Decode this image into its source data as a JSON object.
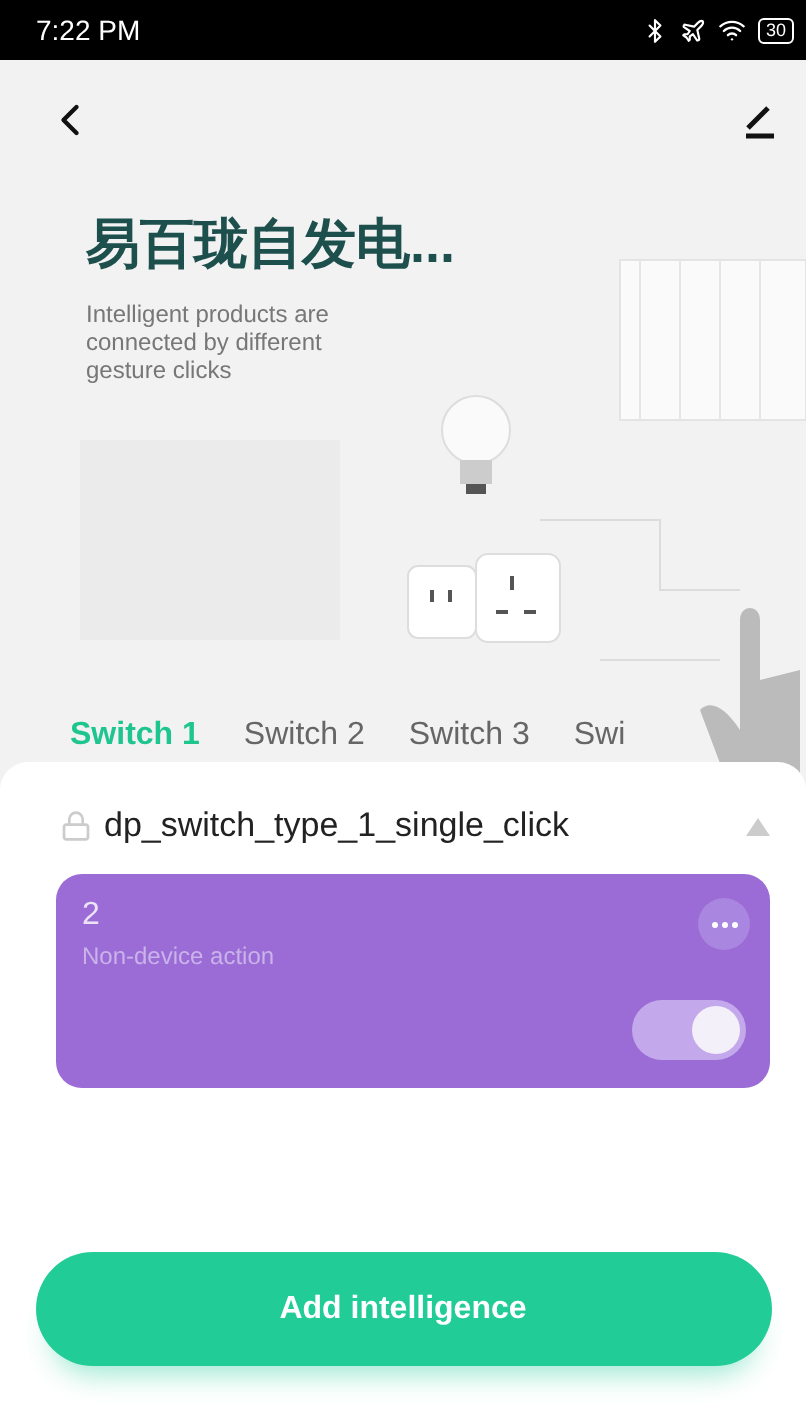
{
  "status_bar": {
    "time": "7:22 PM",
    "battery": "30"
  },
  "hero": {
    "title": "易百珑自发电...",
    "subtitle": "Intelligent products are connected by different gesture clicks"
  },
  "tabs": [
    {
      "label": "Switch 1",
      "selected": true
    },
    {
      "label": "Switch 2",
      "selected": false
    },
    {
      "label": "Switch 3",
      "selected": false
    },
    {
      "label": "Swi",
      "selected": false
    }
  ],
  "rule": {
    "title": "dp_switch_type_1_single_click",
    "expanded": true
  },
  "card": {
    "title": "2",
    "subtitle": "Non-device action",
    "on": true
  },
  "add_button": {
    "label": "Add intelligence"
  }
}
